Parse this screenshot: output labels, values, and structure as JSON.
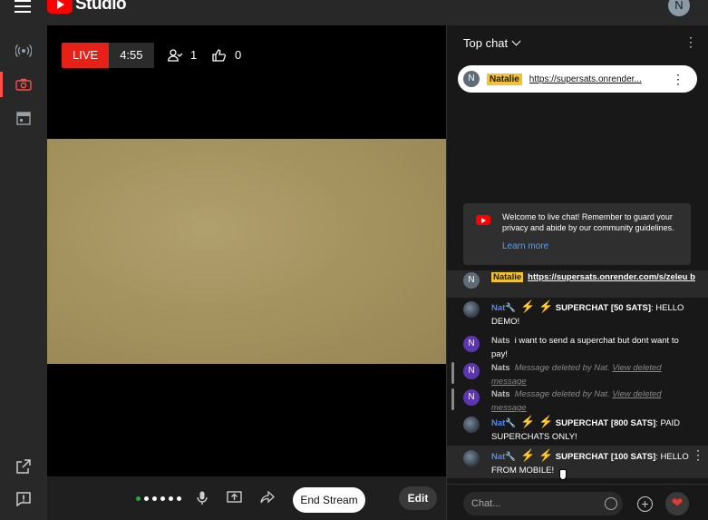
{
  "app": {
    "brand": "Studio",
    "account_initial": "N"
  },
  "nav": {
    "items": [
      "live-icon",
      "camera-icon",
      "calendar-icon",
      "external-link-icon",
      "feedback-icon"
    ]
  },
  "stream": {
    "live_label": "LIVE",
    "elapsed": "4:55",
    "viewers": "1",
    "likes": "0"
  },
  "controls": {
    "end_label": "End Stream",
    "edit_label": "Edit"
  },
  "chat": {
    "mode_label": "Top chat",
    "pinned": {
      "avatar": "N",
      "author": "Natalie",
      "text": "https://supersats.onrender..."
    },
    "welcome": {
      "text": "Welcome to live chat! Remember to guard your privacy and abide by our community guidelines.",
      "link": "Learn more"
    },
    "messages": [
      {
        "avatar": "N",
        "author": "Natalie",
        "text": "https://supersats.onrender.com/s/zeleu b",
        "type": "link"
      },
      {
        "avatar": "",
        "author": "Nat🔧",
        "bolts": "⚡ ⚡",
        "sc": "SUPERCHAT [50 SATS]",
        "text": ": HELLO DEMO!",
        "type": "superchat"
      },
      {
        "avatar": "N",
        "author": "Nats",
        "text": "i want to send a superchat but dont want to pay!",
        "type": "text"
      },
      {
        "avatar": "N",
        "author": "Nats",
        "text": "Message deleted by Nat.",
        "link": "View deleted message",
        "type": "deleted"
      },
      {
        "avatar": "N",
        "author": "Nats",
        "text": "Message deleted by Nat.",
        "link": "View deleted message",
        "type": "deleted"
      },
      {
        "avatar": "",
        "author": "Nat🔧",
        "bolts": "⚡ ⚡",
        "sc": "SUPERCHAT [800 SATS]",
        "text": ": PAID SUPERCHATS ONLY!",
        "type": "superchat"
      },
      {
        "avatar": "",
        "author": "Nat🔧",
        "bolts": "⚡ ⚡",
        "sc": "SUPERCHAT [100 SATS]",
        "text": ": HELLO FROM MOBILE!",
        "type": "superchat"
      }
    ],
    "input_placeholder": "Chat..."
  }
}
